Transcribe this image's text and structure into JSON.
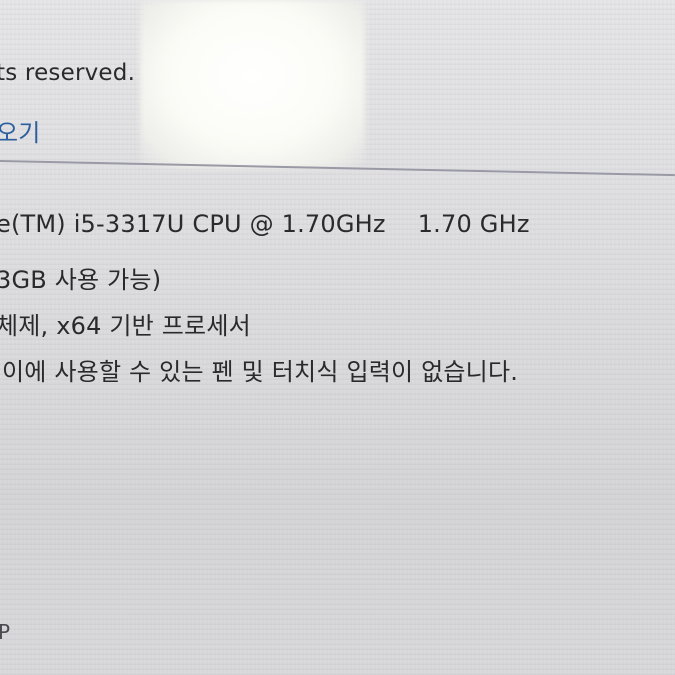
{
  "window": {
    "copyright_fragment": "ts reserved.",
    "link_fragment": "오기"
  },
  "system": {
    "processor_label": "e(TM) i5-3317U CPU @ 1.70GHz",
    "processor_speed": "1.70 GHz",
    "ram": "3GB 사용 가능)",
    "system_type": "체제, x64 기반 프로세서",
    "pen_touch": "이에 사용할 수 있는 펜 및 터치식 입력이 없습니다."
  },
  "footer": {
    "fragment": "P"
  }
}
